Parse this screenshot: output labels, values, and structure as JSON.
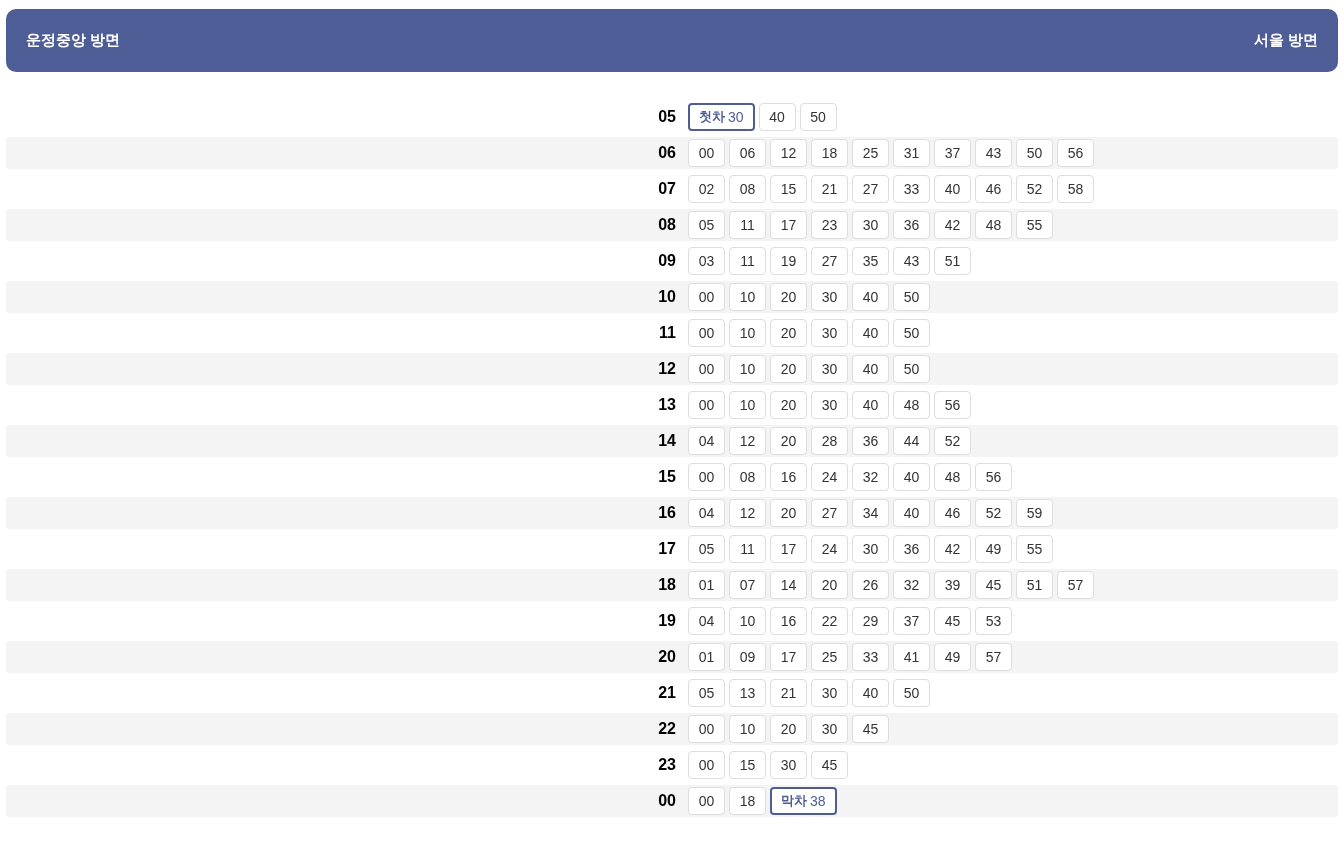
{
  "header": {
    "left": "운정중앙 방면",
    "right": "서울 방면"
  },
  "rows": [
    {
      "hour": "05",
      "minutes": [
        {
          "kind": "first",
          "tag": "첫차",
          "minute": "30"
        },
        {
          "kind": "normal",
          "minute": "40"
        },
        {
          "kind": "normal",
          "minute": "50"
        }
      ]
    },
    {
      "hour": "06",
      "minutes": [
        {
          "kind": "normal",
          "minute": "00"
        },
        {
          "kind": "normal",
          "minute": "06"
        },
        {
          "kind": "normal",
          "minute": "12"
        },
        {
          "kind": "normal",
          "minute": "18"
        },
        {
          "kind": "normal",
          "minute": "25"
        },
        {
          "kind": "normal",
          "minute": "31"
        },
        {
          "kind": "normal",
          "minute": "37"
        },
        {
          "kind": "normal",
          "minute": "43"
        },
        {
          "kind": "normal",
          "minute": "50"
        },
        {
          "kind": "normal",
          "minute": "56"
        }
      ]
    },
    {
      "hour": "07",
      "minutes": [
        {
          "kind": "normal",
          "minute": "02"
        },
        {
          "kind": "normal",
          "minute": "08"
        },
        {
          "kind": "normal",
          "minute": "15"
        },
        {
          "kind": "normal",
          "minute": "21"
        },
        {
          "kind": "normal",
          "minute": "27"
        },
        {
          "kind": "normal",
          "minute": "33"
        },
        {
          "kind": "normal",
          "minute": "40"
        },
        {
          "kind": "normal",
          "minute": "46"
        },
        {
          "kind": "normal",
          "minute": "52"
        },
        {
          "kind": "normal",
          "minute": "58"
        }
      ]
    },
    {
      "hour": "08",
      "minutes": [
        {
          "kind": "normal",
          "minute": "05"
        },
        {
          "kind": "normal",
          "minute": "11"
        },
        {
          "kind": "normal",
          "minute": "17"
        },
        {
          "kind": "normal",
          "minute": "23"
        },
        {
          "kind": "normal",
          "minute": "30"
        },
        {
          "kind": "normal",
          "minute": "36"
        },
        {
          "kind": "normal",
          "minute": "42"
        },
        {
          "kind": "normal",
          "minute": "48"
        },
        {
          "kind": "normal",
          "minute": "55"
        }
      ]
    },
    {
      "hour": "09",
      "minutes": [
        {
          "kind": "normal",
          "minute": "03"
        },
        {
          "kind": "normal",
          "minute": "11"
        },
        {
          "kind": "normal",
          "minute": "19"
        },
        {
          "kind": "normal",
          "minute": "27"
        },
        {
          "kind": "normal",
          "minute": "35"
        },
        {
          "kind": "normal",
          "minute": "43"
        },
        {
          "kind": "normal",
          "minute": "51"
        }
      ]
    },
    {
      "hour": "10",
      "minutes": [
        {
          "kind": "normal",
          "minute": "00"
        },
        {
          "kind": "normal",
          "minute": "10"
        },
        {
          "kind": "normal",
          "minute": "20"
        },
        {
          "kind": "normal",
          "minute": "30"
        },
        {
          "kind": "normal",
          "minute": "40"
        },
        {
          "kind": "normal",
          "minute": "50"
        }
      ]
    },
    {
      "hour": "11",
      "minutes": [
        {
          "kind": "normal",
          "minute": "00"
        },
        {
          "kind": "normal",
          "minute": "10"
        },
        {
          "kind": "normal",
          "minute": "20"
        },
        {
          "kind": "normal",
          "minute": "30"
        },
        {
          "kind": "normal",
          "minute": "40"
        },
        {
          "kind": "normal",
          "minute": "50"
        }
      ]
    },
    {
      "hour": "12",
      "minutes": [
        {
          "kind": "normal",
          "minute": "00"
        },
        {
          "kind": "normal",
          "minute": "10"
        },
        {
          "kind": "normal",
          "minute": "20"
        },
        {
          "kind": "normal",
          "minute": "30"
        },
        {
          "kind": "normal",
          "minute": "40"
        },
        {
          "kind": "normal",
          "minute": "50"
        }
      ]
    },
    {
      "hour": "13",
      "minutes": [
        {
          "kind": "normal",
          "minute": "00"
        },
        {
          "kind": "normal",
          "minute": "10"
        },
        {
          "kind": "normal",
          "minute": "20"
        },
        {
          "kind": "normal",
          "minute": "30"
        },
        {
          "kind": "normal",
          "minute": "40"
        },
        {
          "kind": "normal",
          "minute": "48"
        },
        {
          "kind": "normal",
          "minute": "56"
        }
      ]
    },
    {
      "hour": "14",
      "minutes": [
        {
          "kind": "normal",
          "minute": "04"
        },
        {
          "kind": "normal",
          "minute": "12"
        },
        {
          "kind": "normal",
          "minute": "20"
        },
        {
          "kind": "normal",
          "minute": "28"
        },
        {
          "kind": "normal",
          "minute": "36"
        },
        {
          "kind": "normal",
          "minute": "44"
        },
        {
          "kind": "normal",
          "minute": "52"
        }
      ]
    },
    {
      "hour": "15",
      "minutes": [
        {
          "kind": "normal",
          "minute": "00"
        },
        {
          "kind": "normal",
          "minute": "08"
        },
        {
          "kind": "normal",
          "minute": "16"
        },
        {
          "kind": "normal",
          "minute": "24"
        },
        {
          "kind": "normal",
          "minute": "32"
        },
        {
          "kind": "normal",
          "minute": "40"
        },
        {
          "kind": "normal",
          "minute": "48"
        },
        {
          "kind": "normal",
          "minute": "56"
        }
      ]
    },
    {
      "hour": "16",
      "minutes": [
        {
          "kind": "normal",
          "minute": "04"
        },
        {
          "kind": "normal",
          "minute": "12"
        },
        {
          "kind": "normal",
          "minute": "20"
        },
        {
          "kind": "normal",
          "minute": "27"
        },
        {
          "kind": "normal",
          "minute": "34"
        },
        {
          "kind": "normal",
          "minute": "40"
        },
        {
          "kind": "normal",
          "minute": "46"
        },
        {
          "kind": "normal",
          "minute": "52"
        },
        {
          "kind": "normal",
          "minute": "59"
        }
      ]
    },
    {
      "hour": "17",
      "minutes": [
        {
          "kind": "normal",
          "minute": "05"
        },
        {
          "kind": "normal",
          "minute": "11"
        },
        {
          "kind": "normal",
          "minute": "17"
        },
        {
          "kind": "normal",
          "minute": "24"
        },
        {
          "kind": "normal",
          "minute": "30"
        },
        {
          "kind": "normal",
          "minute": "36"
        },
        {
          "kind": "normal",
          "minute": "42"
        },
        {
          "kind": "normal",
          "minute": "49"
        },
        {
          "kind": "normal",
          "minute": "55"
        }
      ]
    },
    {
      "hour": "18",
      "minutes": [
        {
          "kind": "normal",
          "minute": "01"
        },
        {
          "kind": "normal",
          "minute": "07"
        },
        {
          "kind": "normal",
          "minute": "14"
        },
        {
          "kind": "normal",
          "minute": "20"
        },
        {
          "kind": "normal",
          "minute": "26"
        },
        {
          "kind": "normal",
          "minute": "32"
        },
        {
          "kind": "normal",
          "minute": "39"
        },
        {
          "kind": "normal",
          "minute": "45"
        },
        {
          "kind": "normal",
          "minute": "51"
        },
        {
          "kind": "normal",
          "minute": "57"
        }
      ]
    },
    {
      "hour": "19",
      "minutes": [
        {
          "kind": "normal",
          "minute": "04"
        },
        {
          "kind": "normal",
          "minute": "10"
        },
        {
          "kind": "normal",
          "minute": "16"
        },
        {
          "kind": "normal",
          "minute": "22"
        },
        {
          "kind": "normal",
          "minute": "29"
        },
        {
          "kind": "normal",
          "minute": "37"
        },
        {
          "kind": "normal",
          "minute": "45"
        },
        {
          "kind": "normal",
          "minute": "53"
        }
      ]
    },
    {
      "hour": "20",
      "minutes": [
        {
          "kind": "normal",
          "minute": "01"
        },
        {
          "kind": "normal",
          "minute": "09"
        },
        {
          "kind": "normal",
          "minute": "17"
        },
        {
          "kind": "normal",
          "minute": "25"
        },
        {
          "kind": "normal",
          "minute": "33"
        },
        {
          "kind": "normal",
          "minute": "41"
        },
        {
          "kind": "normal",
          "minute": "49"
        },
        {
          "kind": "normal",
          "minute": "57"
        }
      ]
    },
    {
      "hour": "21",
      "minutes": [
        {
          "kind": "normal",
          "minute": "05"
        },
        {
          "kind": "normal",
          "minute": "13"
        },
        {
          "kind": "normal",
          "minute": "21"
        },
        {
          "kind": "normal",
          "minute": "30"
        },
        {
          "kind": "normal",
          "minute": "40"
        },
        {
          "kind": "normal",
          "minute": "50"
        }
      ]
    },
    {
      "hour": "22",
      "minutes": [
        {
          "kind": "normal",
          "minute": "00"
        },
        {
          "kind": "normal",
          "minute": "10"
        },
        {
          "kind": "normal",
          "minute": "20"
        },
        {
          "kind": "normal",
          "minute": "30"
        },
        {
          "kind": "normal",
          "minute": "45"
        }
      ]
    },
    {
      "hour": "23",
      "minutes": [
        {
          "kind": "normal",
          "minute": "00"
        },
        {
          "kind": "normal",
          "minute": "15"
        },
        {
          "kind": "normal",
          "minute": "30"
        },
        {
          "kind": "normal",
          "minute": "45"
        }
      ]
    },
    {
      "hour": "00",
      "minutes": [
        {
          "kind": "normal",
          "minute": "00"
        },
        {
          "kind": "normal",
          "minute": "18"
        },
        {
          "kind": "last",
          "tag": "막차",
          "minute": "38"
        }
      ]
    }
  ]
}
